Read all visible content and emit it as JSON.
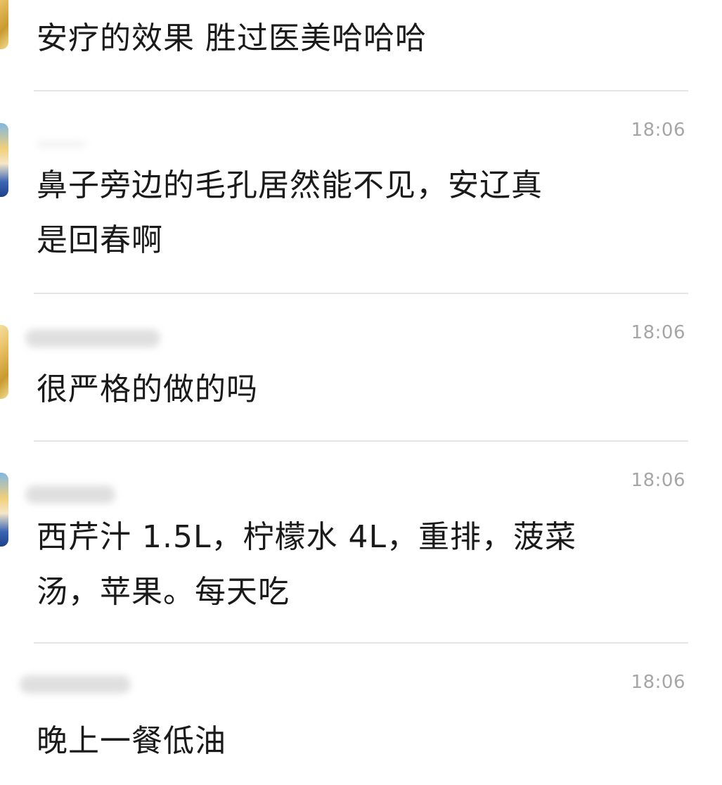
{
  "messages": [
    {
      "text": "安疗的效果 胜过医美哈哈哈",
      "time": "",
      "avatar": "gold-avatar"
    },
    {
      "text": "鼻子旁边的毛孔居然能不见，安辽真\n是回春啊",
      "time": "18:06",
      "avatar": "blue-avatar"
    },
    {
      "text": "很严格的做的吗",
      "time": "18:06",
      "avatar": "gold-avatar"
    },
    {
      "text": "西芹汁 1.5L，柠檬水 4L，重排，菠菜\n汤，苹果。每天吃",
      "time": "18:06",
      "avatar": "blue-avatar"
    },
    {
      "text": "晚上一餐低油",
      "time": "18:06",
      "avatar": "none"
    }
  ],
  "colors": {
    "background": "#ffffff",
    "text": "#1a1a1a",
    "timestamp": "#a6a6a6",
    "divider": "#e5e5e5"
  }
}
